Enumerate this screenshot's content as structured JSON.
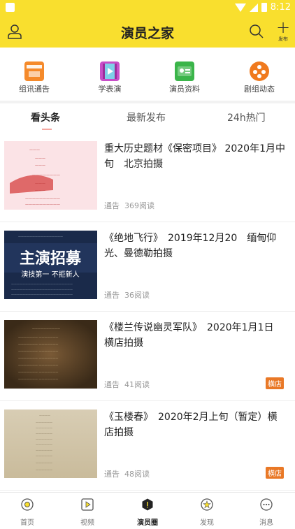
{
  "status": {
    "time": "8:12"
  },
  "header": {
    "title": "演员之家",
    "publish_label": "发布"
  },
  "quick_actions": [
    {
      "label": "组讯通告",
      "icon": "film-notice-icon",
      "color": "#f58a2b"
    },
    {
      "label": "学表演",
      "icon": "film-strip-icon",
      "color": "#c84ec8"
    },
    {
      "label": "演员资料",
      "icon": "profile-card-icon",
      "color": "#3bb54a"
    },
    {
      "label": "剧组动态",
      "icon": "film-reel-icon",
      "color": "#f07a1e"
    }
  ],
  "tabs": [
    "看头条",
    "最新发布",
    "24h热门"
  ],
  "active_tab": "看头条",
  "feed": [
    {
      "title": "重大历史题材《保密项目》 2020年1月中旬　北京拍摄",
      "category": "通告",
      "reads": "369阅读",
      "tag": "",
      "thumb_text": "开机时间 2020年1月中旬"
    },
    {
      "title": "《绝地飞行》　2019年12月20　缅甸仰光、曼德勒拍摄",
      "category": "通告",
      "reads": "36阅读",
      "tag": "",
      "thumb_text": "主演招募",
      "thumb_sub": "演技第一 不拒新人"
    },
    {
      "title": "《楼兰传说幽灵军队》　2020年1月1日　横店拍摄",
      "category": "通告",
      "reads": "41阅读",
      "tag": "横店"
    },
    {
      "title": "《玉楼春》　2020年2月上旬（暂定）横店拍摄",
      "category": "通告",
      "reads": "48阅读",
      "tag": "横店"
    }
  ],
  "bottom_nav": [
    {
      "label": "首页",
      "icon": "home-circle-icon"
    },
    {
      "label": "视频",
      "icon": "video-play-icon"
    },
    {
      "label": "演员圈",
      "icon": "actor-circle-icon"
    },
    {
      "label": "发现",
      "icon": "discover-star-icon"
    },
    {
      "label": "消息",
      "icon": "message-bubble-icon"
    }
  ],
  "active_nav": "演员圈",
  "colors": {
    "brand_yellow": "#f9df2e",
    "tag_orange": "#e97826"
  }
}
